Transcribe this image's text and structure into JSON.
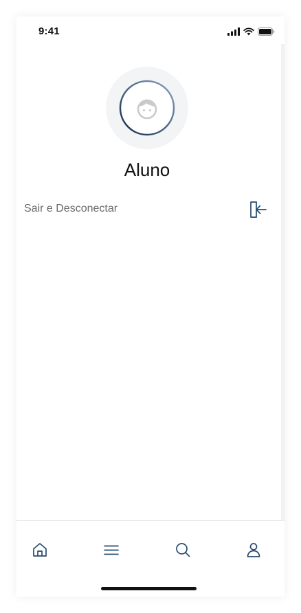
{
  "status_bar": {
    "time": "9:41",
    "icons": [
      "cellular-signal-icon",
      "wifi-icon",
      "battery-icon"
    ]
  },
  "profile": {
    "avatar_icon": "child-face-icon",
    "name": "Aluno"
  },
  "menu": {
    "logout_label": "Sair e Desconectar",
    "logout_icon": "sign-in-arrow-icon"
  },
  "tab_bar": {
    "items": [
      {
        "icon": "home-icon"
      },
      {
        "icon": "menu-icon"
      },
      {
        "icon": "search-icon"
      },
      {
        "icon": "user-icon",
        "active": true
      }
    ]
  },
  "colors": {
    "accent": "#1f3a5f",
    "avatar_background": "#f3f4f6",
    "icon_stroke": "#264a6e",
    "text_primary": "#111111",
    "text_secondary": "#6b6b6b"
  }
}
